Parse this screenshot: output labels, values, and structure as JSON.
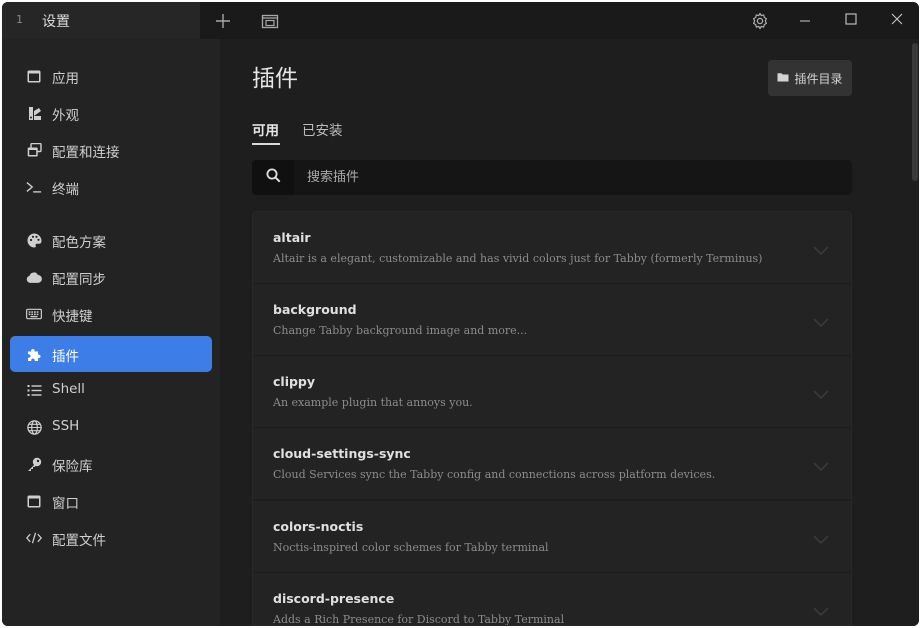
{
  "window": {
    "tab_index": "1",
    "tab_title": "设置"
  },
  "sidebar": {
    "items": [
      {
        "label": "应用",
        "icon": "window-icon"
      },
      {
        "label": "外观",
        "icon": "paint-icon"
      },
      {
        "label": "配置和连接",
        "icon": "profiles-icon"
      },
      {
        "label": "终端",
        "icon": "terminal-icon"
      },
      {
        "label": "配色方案",
        "icon": "palette-icon"
      },
      {
        "label": "配置同步",
        "icon": "cloud-icon"
      },
      {
        "label": "快捷键",
        "icon": "keyboard-icon"
      },
      {
        "label": "插件",
        "icon": "puzzle-icon",
        "active": true
      },
      {
        "label": "Shell",
        "icon": "list-icon"
      },
      {
        "label": "SSH",
        "icon": "globe-icon"
      },
      {
        "label": "保险库",
        "icon": "key-icon"
      },
      {
        "label": "窗口",
        "icon": "window-icon"
      },
      {
        "label": "配置文件",
        "icon": "code-icon"
      }
    ]
  },
  "main": {
    "title": "插件",
    "dir_button": "插件目录",
    "tabs": [
      {
        "label": "可用",
        "active": true
      },
      {
        "label": "已安装",
        "active": false
      }
    ],
    "search_placeholder": "搜索插件",
    "plugins": [
      {
        "name": "altair",
        "description": "Altair is a elegant, customizable and has vivid colors just for Tabby (formerly Terminus)"
      },
      {
        "name": "background",
        "description": "Change Tabby background image and more..."
      },
      {
        "name": "clippy",
        "description": "An example plugin that annoys you."
      },
      {
        "name": "cloud-settings-sync",
        "description": "Cloud Services sync the Tabby config and connections across platform devices."
      },
      {
        "name": "colors-noctis",
        "description": "Noctis-inspired color schemes for Tabby terminal"
      },
      {
        "name": "discord-presence",
        "description": "Adds a Rich Presence for Discord to Tabby Terminal"
      }
    ]
  },
  "colors": {
    "accent": "#3d7de8",
    "background": "#1e1e1e",
    "sidebar": "#232323"
  }
}
